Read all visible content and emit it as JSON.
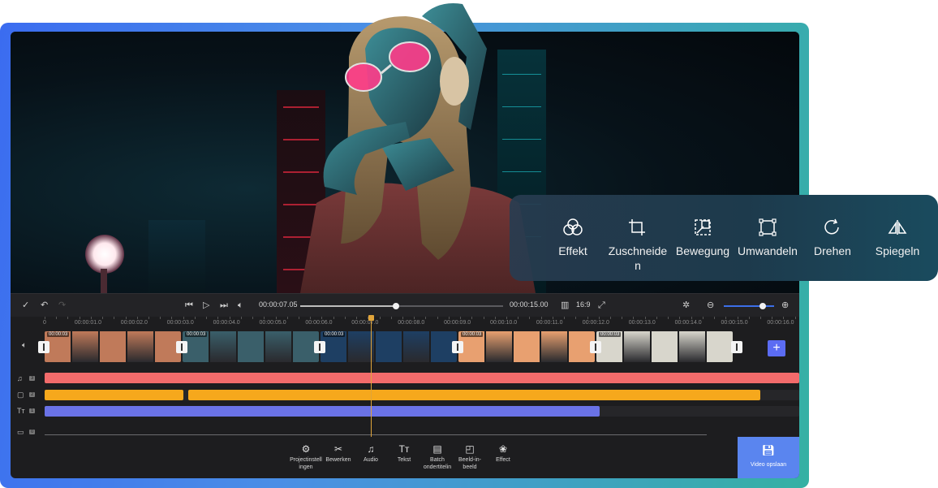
{
  "transport": {
    "current_time": "00:00:07.05",
    "total_time": "00:00:15.00",
    "aspect_ratio": "16:9",
    "progress": 0.47
  },
  "ruler": {
    "labels": [
      "0",
      "00:00:01.0",
      "00:00:02.0",
      "00:00:03.0",
      "00:00:04.0",
      "00:00:05.0",
      "00:00:06.0",
      "00:00:07.0",
      "00:00:08.0",
      "00:00:09.0",
      "00:00:10.0",
      "00:00:11.0",
      "00:00:12.0",
      "00:00:13.0",
      "00:00:14.0",
      "00:00:15.0",
      "00:00:16.0"
    ]
  },
  "video_track": {
    "clips": [
      {
        "duration": "00:00:03",
        "color": "#c07a5a"
      },
      {
        "duration": "00:00:03",
        "color": "#3a5f6a"
      },
      {
        "duration": "00:00:03",
        "color": "#1e3f63"
      },
      {
        "duration": "00:00:03",
        "color": "#e8a070"
      },
      {
        "duration": "00:00:03",
        "color": "#d8d6cc"
      }
    ]
  },
  "tracks": {
    "audio_count": "3",
    "sticker_count": "2",
    "text_count": "1",
    "pip_count": "0",
    "colors": {
      "audio": "#f26b6b",
      "sticker": "#f6a81c",
      "text": "#6a72e6"
    }
  },
  "toolbar": {
    "project_settings": "Projectinstellingen",
    "edit": "Bewerken",
    "audio": "Audio",
    "text": "Tekst",
    "batch_subtitles": "Batch ondertitelin",
    "pip": "Beeld-in-beeld",
    "effect": "Effect",
    "save": "Video opslaan"
  },
  "panel": {
    "effect": "Effekt",
    "crop": "Zuschneide n",
    "motion": "Bewegung",
    "transform": "Umwandeln",
    "rotate": "Drehen",
    "mirror": "Spiegeln"
  },
  "colors": {
    "accent": "#5b6cf3",
    "playhead": "#e0a43a"
  }
}
